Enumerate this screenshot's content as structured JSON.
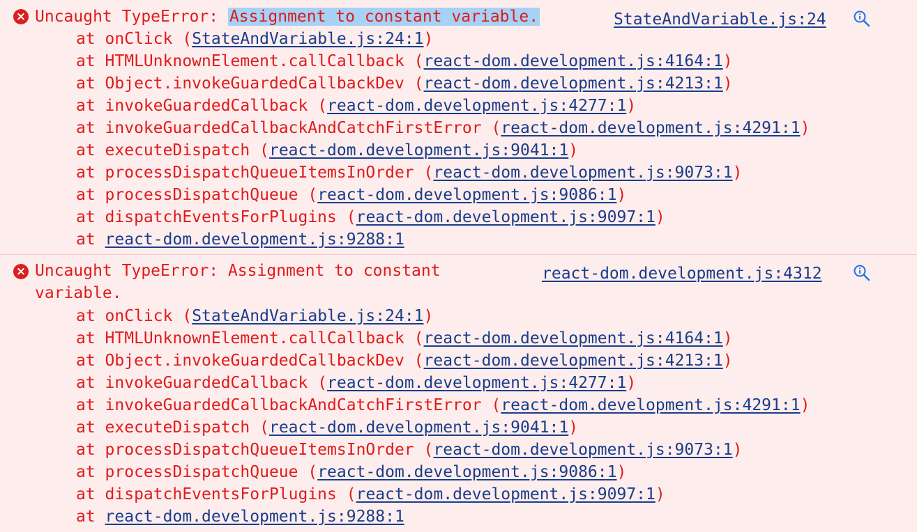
{
  "errors": [
    {
      "prefix": "Uncaught TypeError: ",
      "message": "Assignment to constant variable.",
      "source": "StateAndVariable.js:24",
      "stack": [
        {
          "at": "at ",
          "fn": "onClick ",
          "open": "(",
          "loc": "StateAndVariable.js:24:1",
          "close": ")"
        },
        {
          "at": "at ",
          "fn": "HTMLUnknownElement.callCallback ",
          "open": "(",
          "loc": "react-dom.development.js:4164:1",
          "close": ")"
        },
        {
          "at": "at ",
          "fn": "Object.invokeGuardedCallbackDev ",
          "open": "(",
          "loc": "react-dom.development.js:4213:1",
          "close": ")"
        },
        {
          "at": "at ",
          "fn": "invokeGuardedCallback ",
          "open": "(",
          "loc": "react-dom.development.js:4277:1",
          "close": ")"
        },
        {
          "at": "at ",
          "fn": "invokeGuardedCallbackAndCatchFirstError ",
          "open": "(",
          "loc": "react-dom.development.js:4291:1",
          "close": ")"
        },
        {
          "at": "at ",
          "fn": "executeDispatch ",
          "open": "(",
          "loc": "react-dom.development.js:9041:1",
          "close": ")"
        },
        {
          "at": "at ",
          "fn": "processDispatchQueueItemsInOrder ",
          "open": "(",
          "loc": "react-dom.development.js:9073:1",
          "close": ")"
        },
        {
          "at": "at ",
          "fn": "processDispatchQueue ",
          "open": "(",
          "loc": "react-dom.development.js:9086:1",
          "close": ")"
        },
        {
          "at": "at ",
          "fn": "dispatchEventsForPlugins ",
          "open": "(",
          "loc": "react-dom.development.js:9097:1",
          "close": ")"
        },
        {
          "at": "at ",
          "fn": "",
          "open": "",
          "loc": "react-dom.development.js:9288:1",
          "close": ""
        }
      ]
    },
    {
      "prefix": "Uncaught TypeError: ",
      "message_line1": "Assignment to constant",
      "message_line2": "variable.",
      "source": "react-dom.development.js:4312",
      "stack": [
        {
          "at": "at ",
          "fn": "onClick ",
          "open": "(",
          "loc": "StateAndVariable.js:24:1",
          "close": ")"
        },
        {
          "at": "at ",
          "fn": "HTMLUnknownElement.callCallback ",
          "open": "(",
          "loc": "react-dom.development.js:4164:1",
          "close": ")"
        },
        {
          "at": "at ",
          "fn": "Object.invokeGuardedCallbackDev ",
          "open": "(",
          "loc": "react-dom.development.js:4213:1",
          "close": ")"
        },
        {
          "at": "at ",
          "fn": "invokeGuardedCallback ",
          "open": "(",
          "loc": "react-dom.development.js:4277:1",
          "close": ")"
        },
        {
          "at": "at ",
          "fn": "invokeGuardedCallbackAndCatchFirstError ",
          "open": "(",
          "loc": "react-dom.development.js:4291:1",
          "close": ")"
        },
        {
          "at": "at ",
          "fn": "executeDispatch ",
          "open": "(",
          "loc": "react-dom.development.js:9041:1",
          "close": ")"
        },
        {
          "at": "at ",
          "fn": "processDispatchQueueItemsInOrder ",
          "open": "(",
          "loc": "react-dom.development.js:9073:1",
          "close": ")"
        },
        {
          "at": "at ",
          "fn": "processDispatchQueue ",
          "open": "(",
          "loc": "react-dom.development.js:9086:1",
          "close": ")"
        },
        {
          "at": "at ",
          "fn": "dispatchEventsForPlugins ",
          "open": "(",
          "loc": "react-dom.development.js:9097:1",
          "close": ")"
        },
        {
          "at": "at ",
          "fn": "",
          "open": "",
          "loc": "react-dom.development.js:9288:1",
          "close": ""
        }
      ]
    }
  ],
  "icons": {
    "error": "error-circle-icon",
    "reveal": "magnifier-icon",
    "error_glyph": "×"
  },
  "colors": {
    "error_text": "#e01b1b",
    "link": "#1a3d8a",
    "background": "#fdeded",
    "selection": "#a7d1f5"
  }
}
